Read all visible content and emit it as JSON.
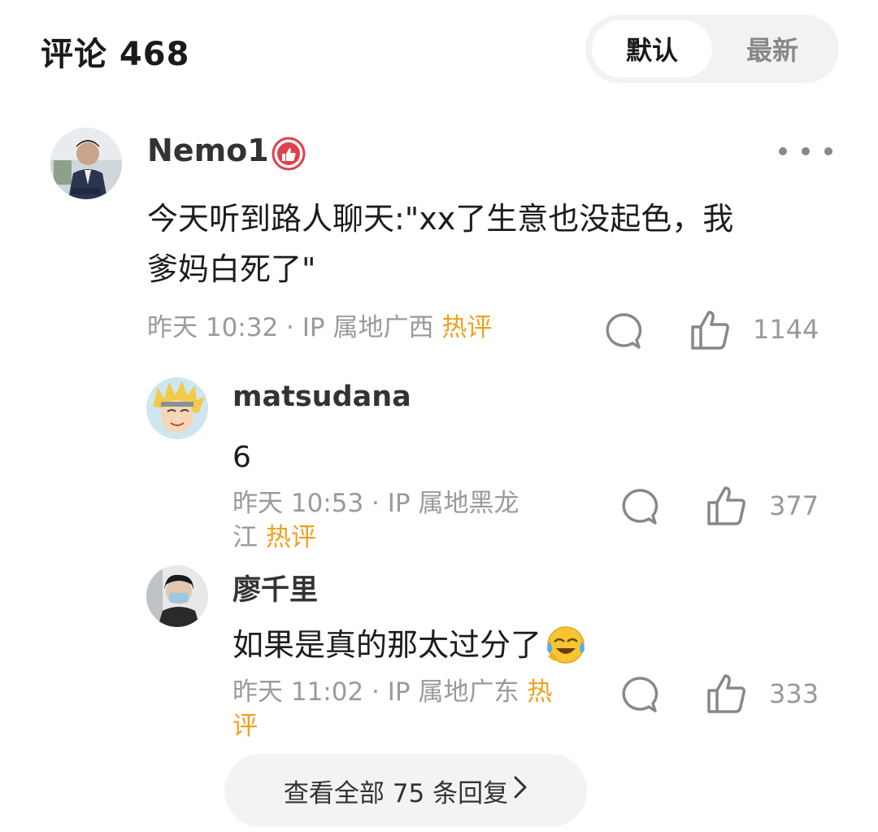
{
  "header": {
    "title": "评论 468",
    "sort_default": "默认",
    "sort_latest": "最新"
  },
  "comment": {
    "user": "Nemo1",
    "badge_icon": "thumbs-up-badge-icon",
    "text_line1": "今天听到路人聊天:\"xx了生意也没起色，我",
    "text_line2": "爹妈白死了\"",
    "time": "昨天 10:32 · IP 属地广西",
    "hot_label": "热评",
    "likes": "1144"
  },
  "replies": [
    {
      "user": "matsudana",
      "text": "6",
      "time_line1": "昨天 10:53 · IP 属地黑龙",
      "time_line2": "江",
      "hot_label": "热评",
      "likes": "377"
    },
    {
      "user": "廖千里",
      "text": "如果是真的那太过分了",
      "emoji": "laughing-crying-emoji",
      "time": "昨天 11:02 · IP 属地广东",
      "hot_label_part1": "热",
      "hot_label_part2": "评",
      "likes": "333"
    }
  ],
  "view_all": "查看全部 75 条回复",
  "colors": {
    "hot": "#f0a020",
    "meta": "#9a9a9a",
    "badge": "#e0404a"
  }
}
